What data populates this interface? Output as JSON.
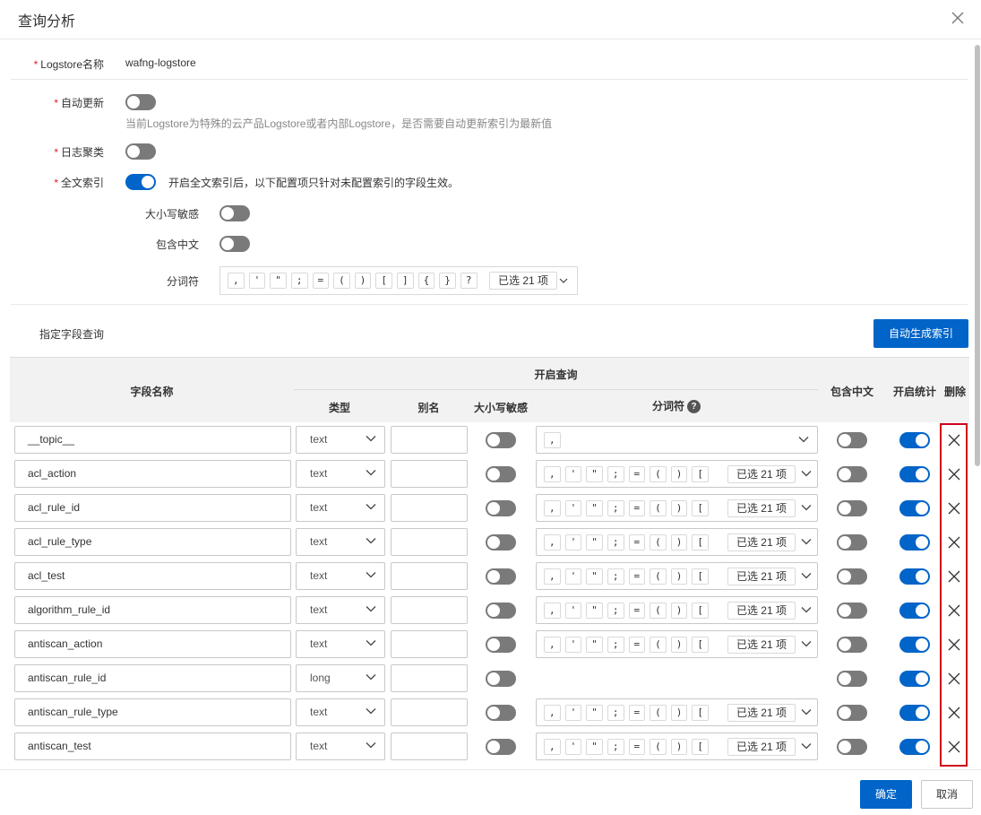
{
  "dialog": {
    "title": "查询分析",
    "close_icon": "close-icon"
  },
  "form": {
    "logstore_label": "Logstore名称",
    "logstore_value": "wafng-logstore",
    "auto_update_label": "自动更新",
    "auto_update_on": false,
    "auto_update_hint": "当前Logstore为特殊的云产品Logstore或者内部Logstore，是否需要自动更新索引为最新值",
    "log_cluster_label": "日志聚类",
    "log_cluster_on": false,
    "fulltext_label": "全文索引",
    "fulltext_on": true,
    "fulltext_hint": "开启全文索引后，以下配置项只针对未配置索引的字段生效。",
    "case_sensitive_label": "大小写敏感",
    "case_sensitive_on": false,
    "include_chinese_label": "包含中文",
    "include_chinese_on": false,
    "separator_label": "分词符",
    "separator_tokens": [
      ",",
      "'",
      "\"",
      ";",
      "=",
      "(",
      ")",
      "[",
      "]",
      "{",
      "}",
      "?"
    ],
    "separator_count": "已选 21 项"
  },
  "field_section": {
    "title": "指定字段查询",
    "auto_index_button": "自动生成索引"
  },
  "table": {
    "headers": {
      "field_name": "字段名称",
      "enable_query": "开启查询",
      "type": "类型",
      "alias": "别名",
      "case_sensitive": "大小写敏感",
      "separator": "分词符",
      "include_chinese": "包含中文",
      "enable_stats": "开启统计",
      "delete": "删除"
    },
    "separator_help_icon": "question-circle-icon",
    "row_separator_tokens": [
      ",",
      "'",
      "\"",
      ";",
      "=",
      "(",
      ")",
      "["
    ],
    "rows": [
      {
        "field": "__topic__",
        "type": "text",
        "alias": "",
        "case": false,
        "sep_mode": "single",
        "sep_single": ",",
        "sep_count": "",
        "chinese": false,
        "stats": true
      },
      {
        "field": "acl_action",
        "type": "text",
        "alias": "",
        "case": false,
        "sep_mode": "full",
        "sep_count": "已选 21 项",
        "chinese": false,
        "stats": true
      },
      {
        "field": "acl_rule_id",
        "type": "text",
        "alias": "",
        "case": false,
        "sep_mode": "full",
        "sep_count": "已选 21 项",
        "chinese": false,
        "stats": true
      },
      {
        "field": "acl_rule_type",
        "type": "text",
        "alias": "",
        "case": false,
        "sep_mode": "full",
        "sep_count": "已选 21 项",
        "chinese": false,
        "stats": true
      },
      {
        "field": "acl_test",
        "type": "text",
        "alias": "",
        "case": false,
        "sep_mode": "full",
        "sep_count": "已选 21 项",
        "chinese": false,
        "stats": true
      },
      {
        "field": "algorithm_rule_id",
        "type": "text",
        "alias": "",
        "case": false,
        "sep_mode": "full",
        "sep_count": "已选 21 项",
        "chinese": false,
        "stats": true
      },
      {
        "field": "antiscan_action",
        "type": "text",
        "alias": "",
        "case": false,
        "sep_mode": "full",
        "sep_count": "已选 21 项",
        "chinese": false,
        "stats": true
      },
      {
        "field": "antiscan_rule_id",
        "type": "long",
        "alias": "",
        "case": false,
        "sep_mode": "none",
        "sep_count": "",
        "chinese": false,
        "stats": true
      },
      {
        "field": "antiscan_rule_type",
        "type": "text",
        "alias": "",
        "case": false,
        "sep_mode": "full",
        "sep_count": "已选 21 项",
        "chinese": false,
        "stats": true
      },
      {
        "field": "antiscan_test",
        "type": "text",
        "alias": "",
        "case": false,
        "sep_mode": "full",
        "sep_count": "已选 21 项",
        "chinese": false,
        "stats": true
      }
    ]
  },
  "footer": {
    "confirm": "确定",
    "cancel": "取消"
  },
  "colors": {
    "primary": "#0064c8",
    "toggle_off": "#7a7a7a",
    "highlight": "#d0021b"
  }
}
